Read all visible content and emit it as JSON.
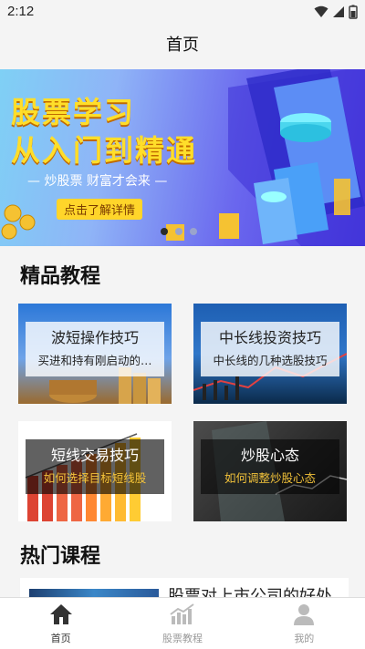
{
  "status": {
    "time": "2:12"
  },
  "header": {
    "title": "首页"
  },
  "banner": {
    "line1": "股票学习",
    "line2": "从入门到精通",
    "slogan": "— 炒股票 财富才会来 —",
    "cta": "点击了解详情"
  },
  "sections": {
    "featured": "精品教程",
    "hot": "热门课程"
  },
  "cards": [
    {
      "name": "波短操作技巧",
      "desc": "买进和持有刚启动的…"
    },
    {
      "name": "中长线投资技巧",
      "desc": "中长线的几种选股技巧"
    },
    {
      "name": "短线交易技巧",
      "desc": "如何选择目标短线股"
    },
    {
      "name": "炒股心态",
      "desc": "如何调整炒股心态"
    }
  ],
  "hot_course": {
    "title": "股票对上市公司的好处"
  },
  "tabs": [
    {
      "label": "首页"
    },
    {
      "label": "股票教程"
    },
    {
      "label": "我的"
    }
  ]
}
